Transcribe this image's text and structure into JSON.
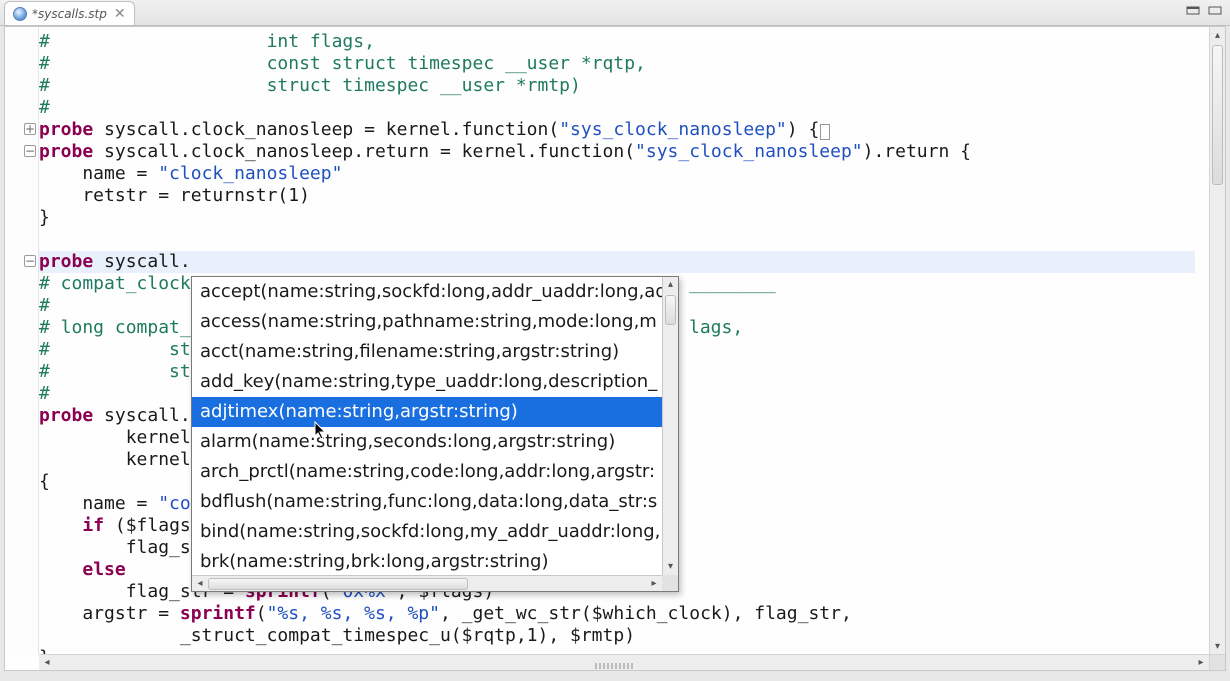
{
  "tab": {
    "title": "*syscalls.stp"
  },
  "code": {
    "lines": [
      {
        "t": "#                    int flags,",
        "cls": "cm"
      },
      {
        "t": "#                    const struct timespec __user *rqtp,",
        "cls": "cm"
      },
      {
        "t": "#                    struct timespec __user *rmtp)",
        "cls": "cm"
      },
      {
        "t": "#",
        "cls": "cm"
      },
      {
        "segs": [
          {
            "t": "probe",
            "c": "kw"
          },
          {
            "t": " syscall.clock_nanosleep = kernel.function("
          },
          {
            "t": "\"sys_clock_nanosleep\"",
            "c": "str"
          },
          {
            "t": ") {"
          },
          {
            "t": "▯",
            "c": "caret"
          }
        ]
      },
      {
        "segs": [
          {
            "t": "probe",
            "c": "kw"
          },
          {
            "t": " syscall.clock_nanosleep.return = kernel.function("
          },
          {
            "t": "\"sys_clock_nanosleep\"",
            "c": "str"
          },
          {
            "t": ").return {"
          }
        ]
      },
      {
        "t": "    name = ",
        "segs": [
          {
            "t": "    name = "
          },
          {
            "t": "\"clock_nanosleep\"",
            "c": "str"
          }
        ]
      },
      {
        "t": "    retstr = returnstr(1)"
      },
      {
        "t": "}"
      },
      {
        "t": ""
      },
      {
        "segs": [
          {
            "t": "probe",
            "c": "kw"
          },
          {
            "t": " syscall."
          }
        ]
      },
      {
        "segs": [
          {
            "t": "# compat_clock",
            "c": "cm"
          },
          {
            "t": "",
            "tail": "                                                   ________",
            "tc": "cm"
          }
        ]
      },
      {
        "t": "#",
        "cls": "cm"
      },
      {
        "segs": [
          {
            "t": "# long compat_",
            "c": "cm"
          },
          {
            "t": "",
            "tail": "                                                   lags,",
            "tc": "cm"
          }
        ]
      },
      {
        "segs": [
          {
            "t": "#           st",
            "c": "cm"
          }
        ]
      },
      {
        "segs": [
          {
            "t": "#           st",
            "c": "cm"
          }
        ]
      },
      {
        "t": "#",
        "cls": "cm"
      },
      {
        "segs": [
          {
            "t": "probe",
            "c": "kw"
          },
          {
            "t": " syscall."
          }
        ]
      },
      {
        "t": "        kernel"
      },
      {
        "t": "        kernel"
      },
      {
        "t": "{"
      },
      {
        "segs": [
          {
            "t": "    name = "
          },
          {
            "t": "\"co",
            "c": "str"
          }
        ]
      },
      {
        "segs": [
          {
            "t": "    "
          },
          {
            "t": "if",
            "c": "kw2"
          },
          {
            "t": " ($flags"
          }
        ]
      },
      {
        "t": "        flag_s"
      },
      {
        "segs": [
          {
            "t": "    "
          },
          {
            "t": "else",
            "c": "kw2"
          }
        ]
      },
      {
        "segs": [
          {
            "t": "        flag_str = "
          },
          {
            "t": "sprintf",
            "c": "kw2"
          },
          {
            "t": "("
          },
          {
            "t": "\"0x%x\"",
            "c": "str"
          },
          {
            "t": ", $flags)"
          }
        ]
      },
      {
        "segs": [
          {
            "t": "    argstr = "
          },
          {
            "t": "sprintf",
            "c": "kw2"
          },
          {
            "t": "("
          },
          {
            "t": "\"%s, %s, %s, %p\"",
            "c": "str"
          },
          {
            "t": ", _get_wc_str($which_clock), flag_str,"
          }
        ]
      },
      {
        "t": "             _struct_compat_timespec_u($rqtp,1), $rmtp)"
      },
      {
        "t": "}"
      }
    ]
  },
  "highlight_line_index": 10,
  "folds": [
    {
      "line": 4,
      "kind": "plus"
    },
    {
      "line": 5,
      "kind": "minus"
    },
    {
      "line": 10,
      "kind": "minus"
    }
  ],
  "autocomplete": {
    "selected_index": 4,
    "items": [
      "accept(name:string,sockfd:long,addr_uaddr:long,ad",
      "access(name:string,pathname:string,mode:long,m",
      "acct(name:string,filename:string,argstr:string)",
      "add_key(name:string,type_uaddr:long,description_",
      "adjtimex(name:string,argstr:string)",
      "alarm(name:string,seconds:long,argstr:string)",
      "arch_prctl(name:string,code:long,addr:long,argstr:",
      "bdflush(name:string,func:long,data:long,data_str:s",
      "bind(name:string,sockfd:long,my_addr_uaddr:long,",
      "brk(name:string,brk:long,argstr:string)"
    ]
  },
  "background_tails": {
    "11": "________",
    "13": "lags,"
  }
}
